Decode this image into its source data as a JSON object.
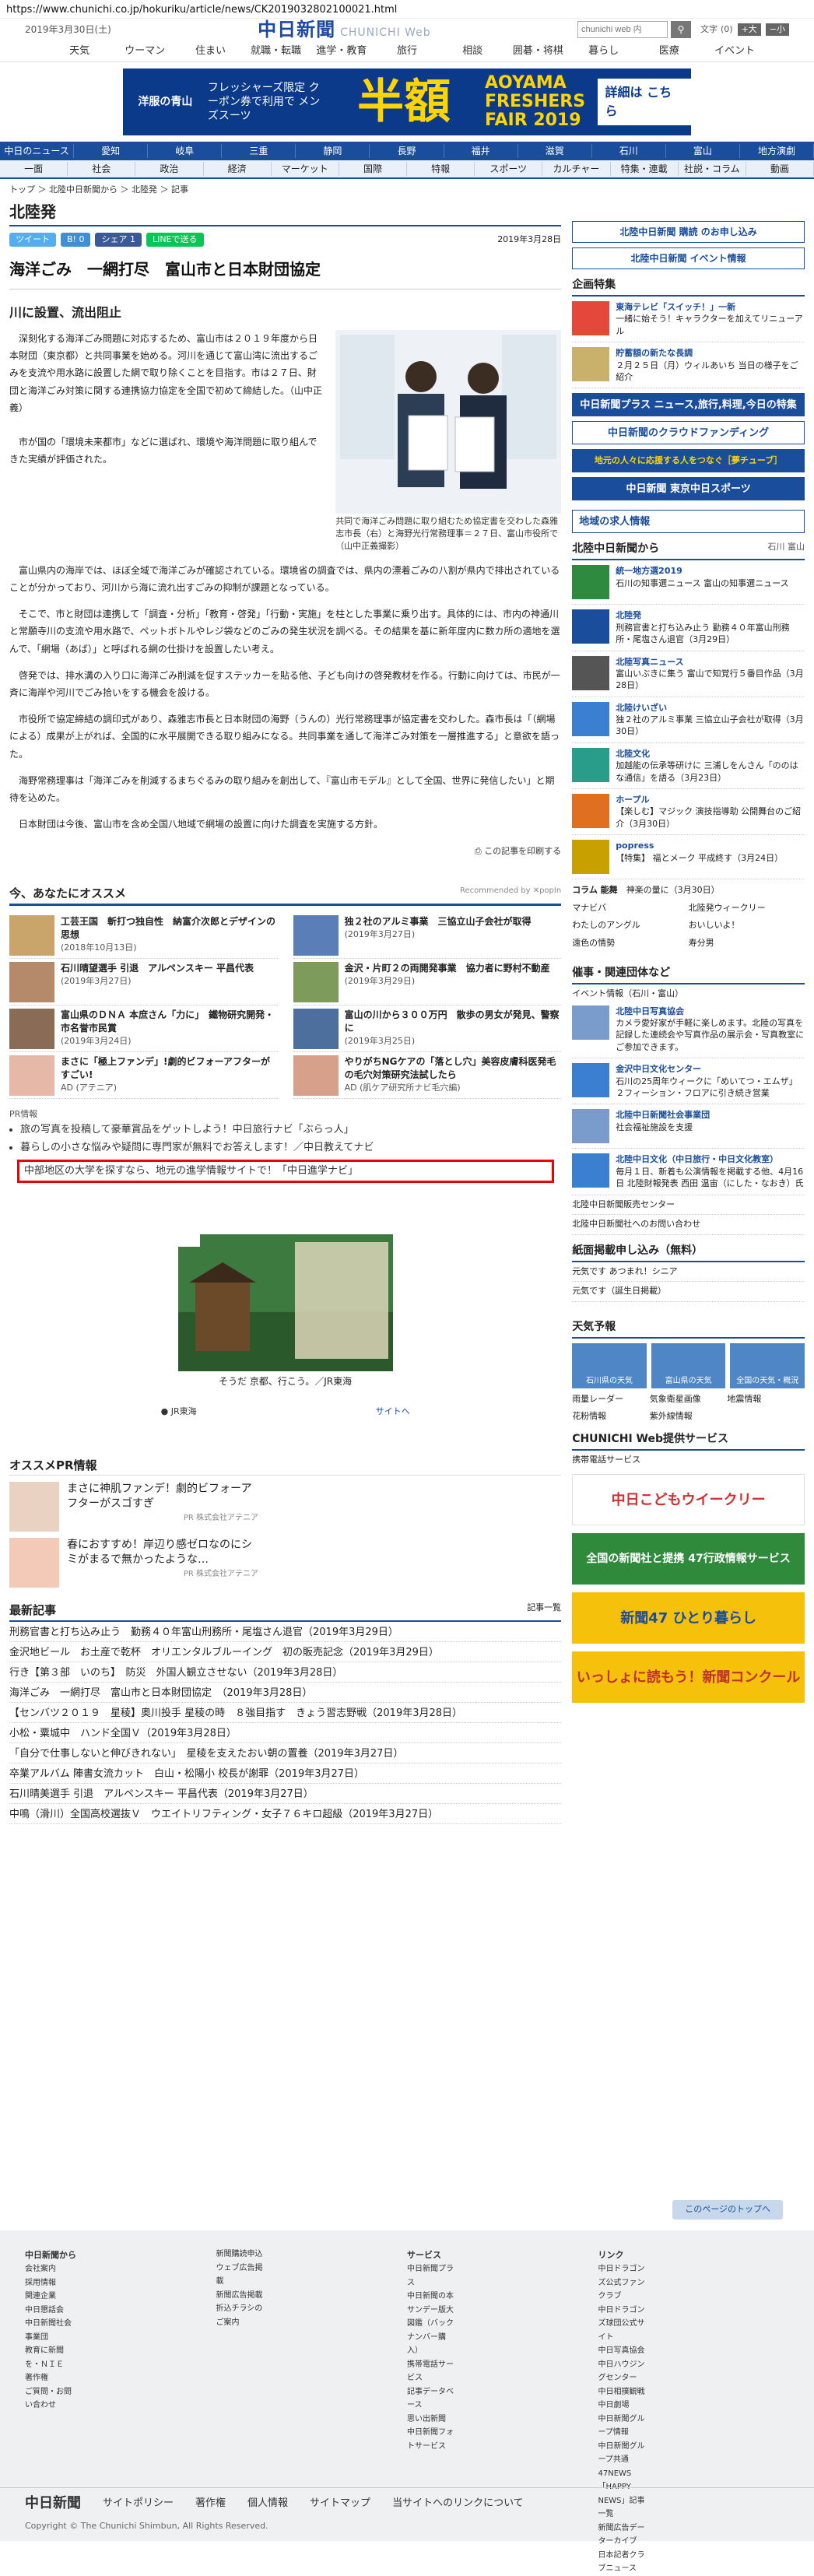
{
  "url": "https://www.chunichi.co.jp/hokuriku/article/news/CK2019032802100021.html",
  "top": {
    "date": "2019年3月30日(土)",
    "logo": "中日新聞",
    "logo_web": "CHUNICHI Web",
    "search_placeholder": "chunichi web 内",
    "font_label": "文字",
    "font_default": "(0)",
    "font_large": "+大",
    "font_small": "−小"
  },
  "topnav": [
    "天気",
    "ウーマン",
    "住まい",
    "就職・転職",
    "進学・教育",
    "旅行",
    "相談",
    "囲碁・将棋",
    "暮らし",
    "医療",
    "イベント"
  ],
  "banner": {
    "shop": "洋服の青山",
    "coupon": "フレッシャーズ限定 クーポン券で利用で メンズスーツ",
    "half": "半額",
    "fair": "AOYAMA FRESHERS FAIR 2019",
    "detail": "詳細は こちら"
  },
  "mainnav": [
    "中日のニュース",
    "愛知",
    "岐阜",
    "三重",
    "静岡",
    "長野",
    "福井",
    "滋賀",
    "石川",
    "富山",
    "地方演劇"
  ],
  "subnav": [
    "一面",
    "社会",
    "政治",
    "経済",
    "マーケット",
    "国際",
    "特報",
    "スポーツ",
    "カルチャー",
    "特集・連載",
    "社説・コラム",
    "動画"
  ],
  "article": {
    "breadcrumb": "トップ ＞ 北陸中日新聞から ＞ 北陸発 ＞ 記事",
    "section": "北陸発",
    "share": [
      "ツイート",
      "B! 0",
      "シェア 1",
      "LINEで送る"
    ],
    "date": "2019年3月28日",
    "title": "海洋ごみ　一網打尽　富山市と日本財団協定",
    "subhead": "川に設置、流出阻止",
    "lead": "深刻化する海洋ごみ問題に対応するため、富山市は２０１９年度から日本財団（東京都）と共同事業を始める。河川を通じて富山湾に流出するごみを支流や用水路に設置した網で取り除くことを目指す。市は２７日、財団と海洋ごみ対策に関する連携協力協定を全国で初めて締結した。（山中正義）",
    "lead2": "市が国の「環境未来都市」などに選ばれ、環境や海洋問題に取り組んできた実績が評価された。",
    "photo_caption": "共同で海洋ごみ問題に取り組むため協定書を交わした森雅志市長（右）と海野光行常務理事＝２７日、富山市役所で（山中正義撮影）",
    "paragraphs": [
      "富山県内の海岸では、ほぼ全域で海洋ごみが確認されている。環境省の調査では、県内の漂着ごみの八割が県内で排出されていることが分かっており、河川から海に流れ出すごみの抑制が課題となっている。",
      "そこで、市と財団は連携して「調査・分析」「教育・啓発」「行動・実施」を柱とした事業に乗り出す。具体的には、市内の神通川と常願寺川の支流や用水路で、ペットボトルやレジ袋などのごみの発生状況を調べる。その結果を基に新年度内に数カ所の適地を選んで、「網場（あば）」と呼ばれる網の仕掛けを設置したい考え。",
      "啓発では、排水溝の入り口に海洋ごみ削減を促すステッカーを貼る他、子ども向けの啓発教材を作る。行動に向けては、市民が一斉に海岸や河川でごみ拾いをする機会を設ける。",
      "市役所で協定締結の調印式があり、森雅志市長と日本財団の海野（うんの）光行常務理事が協定書を交わした。森市長は「（網場による）成果が上がれば、全国的に水平展開できる取り組みになる。共同事業を通して海洋ごみ対策を一層推進する」と意欲を語った。",
      "海野常務理事は「海洋ごみを削減するまちぐるみの取り組みを創出して、『富山市モデル』として全国、世界に発信したい」と期待を込めた。",
      "日本財団は今後、富山市を含め全国八地域で網場の設置に向けた調査を実施する方針。"
    ],
    "print": "この記事を印刷する"
  },
  "recommend": {
    "heading": "今、あなたにオススメ",
    "by": "Recommended by ✕popIn",
    "items": [
      {
        "t": "工芸王国　斬打つ独自性　納富介次郎とデザインの思想",
        "d": "(2018年10月13日)"
      },
      {
        "t": "独２社のアルミ事業　三協立山子会社が取得",
        "d": "(2019年3月27日)"
      },
      {
        "t": "石川晴望選手 引退　アルペンスキー 平昌代表",
        "d": "(2019年3月27日)"
      },
      {
        "t": "金沢・片町２の両開発事業　協力者に野村不動産",
        "d": "(2019年3月29日)"
      },
      {
        "t": "富山県のＤＮＡ 本庶さん「力に」　鐵物研究開発・市名誉市民賞",
        "d": "(2019年3月24日)"
      },
      {
        "t": "富山の川から３００万円　散歩の男女が発見、警察に",
        "d": "(2019年3月25日)"
      },
      {
        "t": "まさに「極上ファンデ」!劇的ビフォーアフターがすごい!",
        "d": "AD (アテニア)"
      },
      {
        "t": "やりがちNGケアの「落とし穴」美容皮膚科医発毛の毛穴対策研究法試したら",
        "d": "AD (肌ケア研究所ナビ毛穴編)"
      }
    ]
  },
  "pr": {
    "label": "PR情報",
    "items": [
      "旅の写真を投稿して豪華賞品をゲットしよう！中日旅行ナビ「ぶらっ人」",
      "暮らしの小さな悩みや疑問に専門家が無料でお答えします！／中日教えてナビ"
    ],
    "highlight": "中部地区の大学を探すなら、地元の進学情報サイトで！「中日進学ナビ」",
    "ad_caption": "そうだ 京都、行こう。／JR東海",
    "ad_sponsor": "JR東海",
    "ad_more": "サイトへ"
  },
  "ospr": {
    "heading": "オススメPR情報",
    "items": [
      {
        "t": "まさに神肌ファンデ！劇的ビフォーアフターがスゴすぎ",
        "d": "PR 株式会社アテニア"
      },
      {
        "t": "春におすすめ！岸辺り感ゼロなのにシミがまるで無かったような…",
        "d": "PR 株式会社アテニア"
      }
    ]
  },
  "latest": {
    "heading": "最新記事",
    "more": "記事一覧",
    "items": [
      "刑務官書と打ち込み止う　勤務４０年富山刑務所・尾塩さん退官（2019年3月29日）",
      "金沢地ビール　お土産で乾杯　オリエンタルブルーイング　初の販売記念（2019年3月29日）",
      "行き【第３部　いのち】　防災　外国人観立させない（2019年3月28日）",
      "海洋ごみ　一網打尽　富山市と日本財団協定　（2019年3月28日）",
      "【センバツ２０１９　星稜】奥川投手 星稜の時　８強目指す　きょう習志野戦（2019年3月28日）",
      "小松・粟城中　ハンド全国Ｖ（2019年3月28日）",
      "「自分で仕事しないと伸びきれない」　星稜を支えたおい朝の置養（2019年3月27日）",
      "卒業アルバム 陣書女流カット　白山・松陽小 校長が謝罪（2019年3月27日）",
      "石川晴美選手 引退　アルペンスキー 平昌代表（2019年3月27日）",
      "中鳴（滑川）全国高校選抜Ｖ　ウエイトリフティング・女子７６キロ超級（2019年3月27日）"
    ]
  },
  "side": {
    "b1": "北陸中日新聞 購読 のお申し込み",
    "b2": "北陸中日新聞 イベント情報",
    "feature_h": "企画特集",
    "feature": [
      {
        "t": "東海テレビ「スイッチ！」一新",
        "s": "一緒に始そう！キャラクターを加えてリニューアル"
      },
      {
        "t": "貯蓄額の新たな長調",
        "s": "２月２５日（月）ウィルあいち 当日の様子をご紹介"
      }
    ],
    "plus": "中日新聞プラス ニュース,旅行,料理,今日の特集",
    "cf": "中日新聞のクラウドファンディング",
    "cf2": "地元の人々に応援する人をつなぐ［夢チューブ］",
    "ads": "中日新聞 東京中日スポーツ",
    "local": "地域の求人情報",
    "hokuriku_h": "北陸中日新聞から",
    "hokuriku_tags": [
      "石川",
      "富山"
    ],
    "hokuriku": [
      {
        "tag": "統一地方選2019",
        "t": "石川の知事選ニュース 富山の知事選ニュース"
      },
      {
        "tag": "北陸発",
        "t": "刑務官書と打ち込み止う 勤務４０年富山刑務所・尾塩さん退官（3月29日）"
      },
      {
        "tag": "北陸写真ニュース",
        "t": "富山いぶきに集う 富山で知覚行５番目作品（3月28日）"
      },
      {
        "tag": "北陸けいざい",
        "t": "独２社のアルミ事業 三協立山子会社が取得（3月30日）"
      },
      {
        "tag": "北陸文化",
        "t": "加越能の伝承等研けに 三浦しをんさん「ののはな通信」を語る（3月23日）"
      },
      {
        "tag": "ホープル",
        "t": "【楽しむ】マジック 演技指導助 公開舞台のご紹介（3月30日）"
      },
      {
        "tag": "popress",
        "t": "【特集】 福とメーク 平成終す（3月24日）"
      }
    ],
    "column": "コラム 能舞",
    "column_t": "神楽の量に（3月30日）",
    "links": [
      "マナビバ",
      "北陸発ウィークリー",
      "わたしのアングル",
      "おいしいよ！",
      "遠色の情勢",
      "寿分男"
    ],
    "biz_h": "催事・関連団体など",
    "biz_tag": "イベント情報（石川・富山）",
    "biz": [
      {
        "t": "北陸中日写真協会",
        "s": "カメラ愛好家が手軽に楽しめます。北陸の写真を記録した連続会や写真作品の展示会・写真教室にご参加できます。"
      },
      {
        "t": "金沢中日文化センター",
        "s": "石川の25周年ウィークに「めいてつ・エムザ」２フィーション・フロアに引き続き営業"
      },
      {
        "t": "北陸中日新聞社会事業団",
        "s": "社会福祉施設を支援"
      },
      {
        "t": "北陸中日文化（中日旅行・中日文化教室）",
        "s": "毎月１日、新着も公演情報を掲載する他、4月16日 北陸財報発表 西田 温宙（にした・なおき）氏"
      }
    ],
    "smore": [
      "北陸中日新聞販売センター",
      "北陸中日新聞社へのお問い合わせ"
    ],
    "apply_h": "紙面掲載申し込み（無料）",
    "apply": [
      "元気です あつまれ！シニア",
      "元気です（誕生日掲載）"
    ],
    "weather_h": "天気予報",
    "weather": [
      "石川県の天気",
      "富山県の天気",
      "全国の天気・概況"
    ],
    "weather_links": [
      "雨量レーダー",
      "気象衛星画像",
      "地震情報",
      "花粉情報",
      "紫外線情報"
    ],
    "service_h": "CHUNICHI Web提供サービス",
    "service": "携帯電話サービス",
    "banners": [
      "中日こどもウイークリー",
      "全国の新聞社と提携 47行政情報サービス",
      "新聞47 ひとり暮らし",
      "いっしょに読もう！新聞コンクール"
    ]
  },
  "totop": "このページのトップへ",
  "footer": {
    "cols": [
      {
        "h": "中日新聞から",
        "items": [
          "会社案内",
          "採用情報",
          "関連企業",
          "中日懇話会",
          "中日新聞社会事業団",
          "教育に新聞を・ＮＩＥ",
          "著作権",
          "ご質問・お問い合わせ"
        ]
      },
      {
        "h": "",
        "items": [
          "新聞購読申込",
          "ウェブ広告掲載",
          "新聞広告掲載",
          "折込チラシのご案内"
        ]
      },
      {
        "h": "サービス",
        "items": [
          "中日新聞プラス",
          "中日新聞の本",
          "サンデー版大図鑑（バックナンバー購入）",
          "携帯電話サービス",
          "記事データベース",
          "思い出新聞",
          "中日新聞フォトサービス"
        ]
      },
      {
        "h": "リンク",
        "items": [
          "中日ドラゴンズ公式ファンクラブ",
          "中日ドラゴンズ球団公式サイト",
          "中日写真協会",
          "中日ハウジングセンター",
          "中日相撲観戦",
          "中日劇場",
          "中日新聞グループ情報",
          "中日新聞グループ共通",
          "47NEWS",
          "「HAPPY NEWS」記事一覧",
          "新聞広告データーカイブ",
          "日本記者クラブニュース"
        ]
      }
    ],
    "logo": "中日新聞",
    "links": [
      "サイトポリシー",
      "著作権",
      "個人情報",
      "サイトマップ",
      "当サイトへのリンクについて"
    ],
    "copy": "Copyright © The Chunichi Shimbun, All Rights Reserved."
  }
}
